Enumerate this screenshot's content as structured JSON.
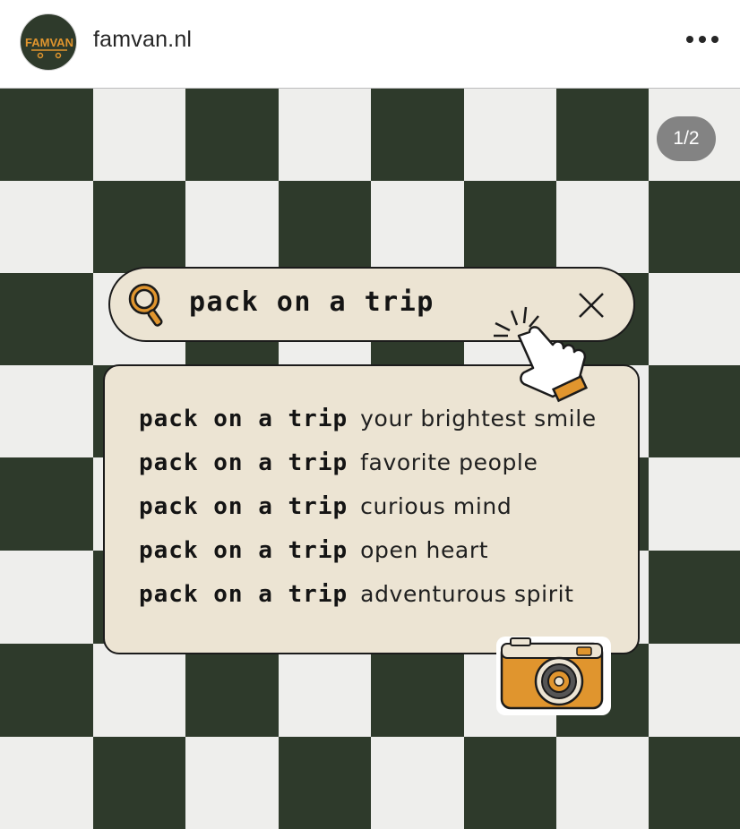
{
  "header": {
    "avatar_text": "FAMVAN",
    "username": "famvan.nl",
    "more_icon": "more-horizontal-icon"
  },
  "post": {
    "counter": "1/2",
    "colors": {
      "dark": "#2e3a2b",
      "light": "#eeeeec",
      "cream": "#ece4d3",
      "accent": "#e0952e"
    },
    "search": {
      "query": "pack on a trip",
      "search_icon": "magnifier-icon",
      "clear_icon": "close-icon"
    },
    "suggestions": [
      {
        "query": "pack on a trip",
        "suffix": "your brightest smile"
      },
      {
        "query": "pack on a trip",
        "suffix": "favorite people"
      },
      {
        "query": "pack on a trip",
        "suffix": "curious mind"
      },
      {
        "query": "pack on a trip",
        "suffix": "open heart"
      },
      {
        "query": "pack on a trip",
        "suffix": "adventurous spirit"
      }
    ],
    "stickers": [
      "pointing-hand-icon",
      "camera-icon"
    ]
  }
}
